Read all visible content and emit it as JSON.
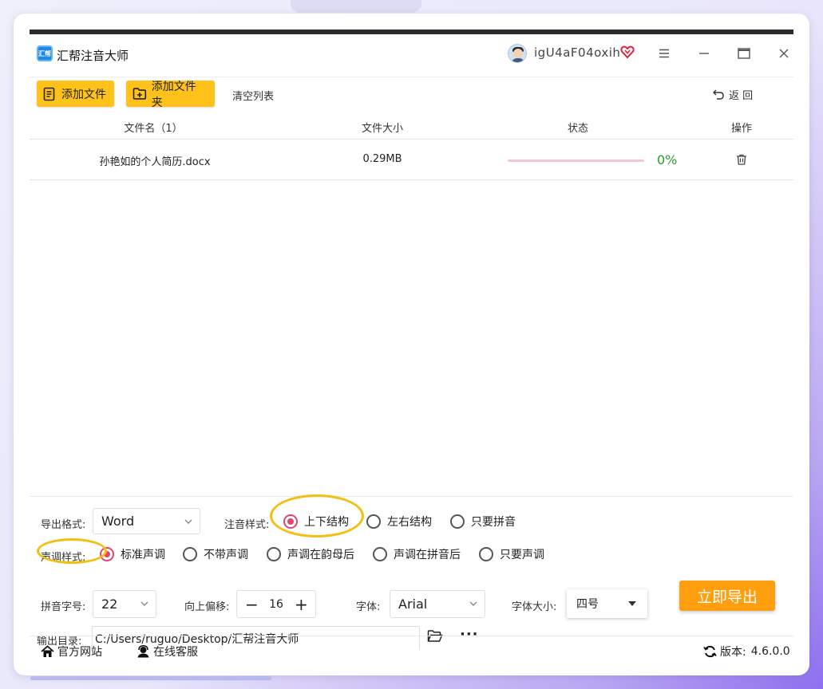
{
  "app": {
    "title": "汇帮注音大师",
    "logo_text": "汇帮",
    "username": "igU4aF04oxih"
  },
  "toolbar": {
    "add_file_label": "添加文件",
    "add_folder_label": "添加文件夹",
    "clear_list_label": "清空列表",
    "back_label": "返 回"
  },
  "table": {
    "headers": [
      "文件名（1）",
      "文件大小",
      "状态",
      "操作"
    ],
    "rows": [
      {
        "name": "孙艳如的个人简历.docx",
        "size": "0.29MB",
        "progress": 0,
        "progress_text": "0%"
      }
    ]
  },
  "settings": {
    "export_format_label": "导出格式:",
    "export_format_value": "Word",
    "annotation_style_label": "注音样式:",
    "annotation_options": [
      "上下结构",
      "左右结构",
      "只要拼音"
    ],
    "annotation_selected": "上下结构",
    "tone_style_label": "声调样式:",
    "tone_options": [
      "标准声调",
      "不带声调",
      "声调在韵母后",
      "声调在拼音后",
      "只要声调"
    ],
    "tone_selected": "标准声调",
    "pinyin_size_label": "拼音字号:",
    "pinyin_size_value": "22",
    "offset_label": "向上偏移:",
    "offset_value": "16",
    "font_label": "字体:",
    "font_value": "Arial",
    "font_size_label": "字体大小:",
    "font_size_value": "四号",
    "output_dir_label": "输出目录:",
    "output_dir_value": "C:/Users/ruguo/Desktop/汇帮注音大师",
    "export_button_label": "立即导出"
  },
  "footer": {
    "website_label": "官方网站",
    "support_label": "在线客服",
    "version_label": "版本:",
    "version_value": "4.6.0.0"
  },
  "colors": {
    "accent_yellow": "#ffc21a",
    "export_orange": "#ff9f10",
    "radio_pink": "#e0456f",
    "progress_green": "#2e9a2e",
    "highlight_ring": "#f4be13"
  }
}
